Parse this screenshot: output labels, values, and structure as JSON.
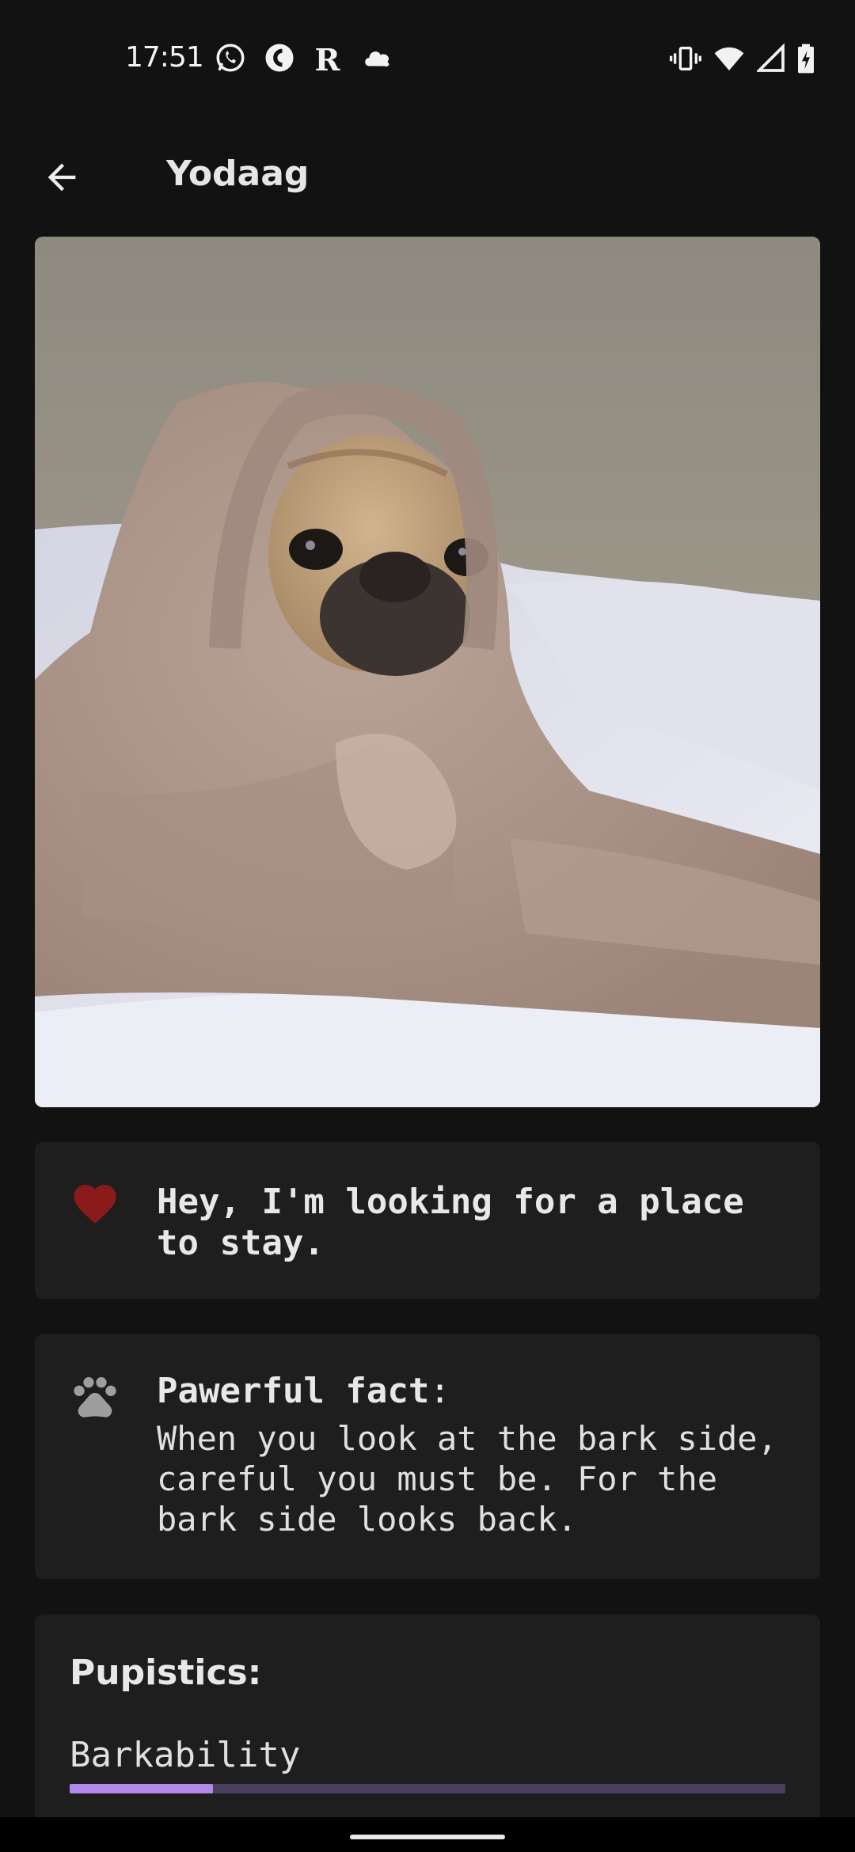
{
  "status_bar": {
    "time": "17:51",
    "notification_icons": [
      "whatsapp-icon",
      "app-c-icon",
      "app-r-icon",
      "cloud-icon"
    ],
    "system_icons": [
      "vibrate-icon",
      "wifi-icon",
      "signal-icon",
      "battery-charging-icon"
    ]
  },
  "app_bar": {
    "title": "Yodaag",
    "back_icon": "arrow-back-icon"
  },
  "photo": {
    "description_icon": "pug-photo"
  },
  "greeting": {
    "icon": "heart-icon",
    "text": "Hey, I'm looking for a place to stay."
  },
  "fact": {
    "icon": "paw-icon",
    "title": "Pawerful fact",
    "title_suffix": ":",
    "text": "When you look at the bark side, careful you must be. For the bark side looks back."
  },
  "stats": {
    "title": "Pupistics:",
    "items": [
      {
        "label": "Barkability",
        "fraction": 0.2
      }
    ]
  },
  "colors": {
    "background": "#121212",
    "card": "#1e1e1e",
    "heart": "#8b1a1a",
    "accent": "#b388eb",
    "track": "#4a3f5f"
  }
}
